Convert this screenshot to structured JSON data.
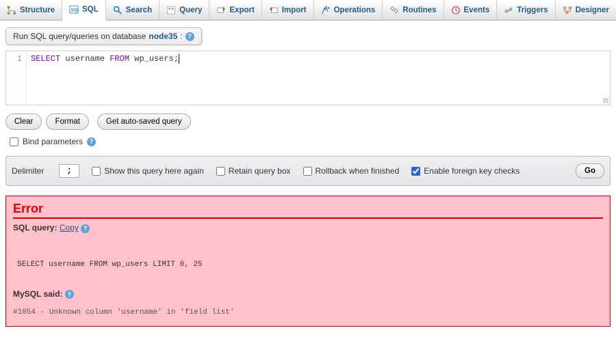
{
  "tabs": {
    "structure": "Structure",
    "sql": "SQL",
    "search": "Search",
    "query": "Query",
    "export": "Export",
    "import": "Import",
    "operations": "Operations",
    "routines": "Routines",
    "events": "Events",
    "triggers": "Triggers",
    "designer": "Designer"
  },
  "title": {
    "prefix": "Run SQL query/queries on database ",
    "dbname": "node35",
    "suffix": ":"
  },
  "editor": {
    "line1_no": "1",
    "kw_select": "SELECT",
    "txt_mid": " username ",
    "kw_from": "FROM",
    "txt_end": " wp_users;"
  },
  "buttons": {
    "clear": "Clear",
    "format": "Format",
    "autosaved": "Get auto-saved query",
    "go": "Go"
  },
  "bind": {
    "label": "Bind parameters"
  },
  "options": {
    "delimiter_label": "Delimiter",
    "delimiter_value": ";",
    "show_again": "Show this query here again",
    "retain": "Retain query box",
    "rollback": "Rollback when finished",
    "fk": "Enable foreign key checks"
  },
  "error": {
    "title": "Error",
    "sql_label": "SQL query:",
    "copy": "Copy",
    "executed_sql": "SELECT username FROM  wp_users LIMIT 0, 25",
    "mysql_said": "MySQL said:",
    "message": "#1054 - Unknown column 'username' in 'field list'"
  }
}
